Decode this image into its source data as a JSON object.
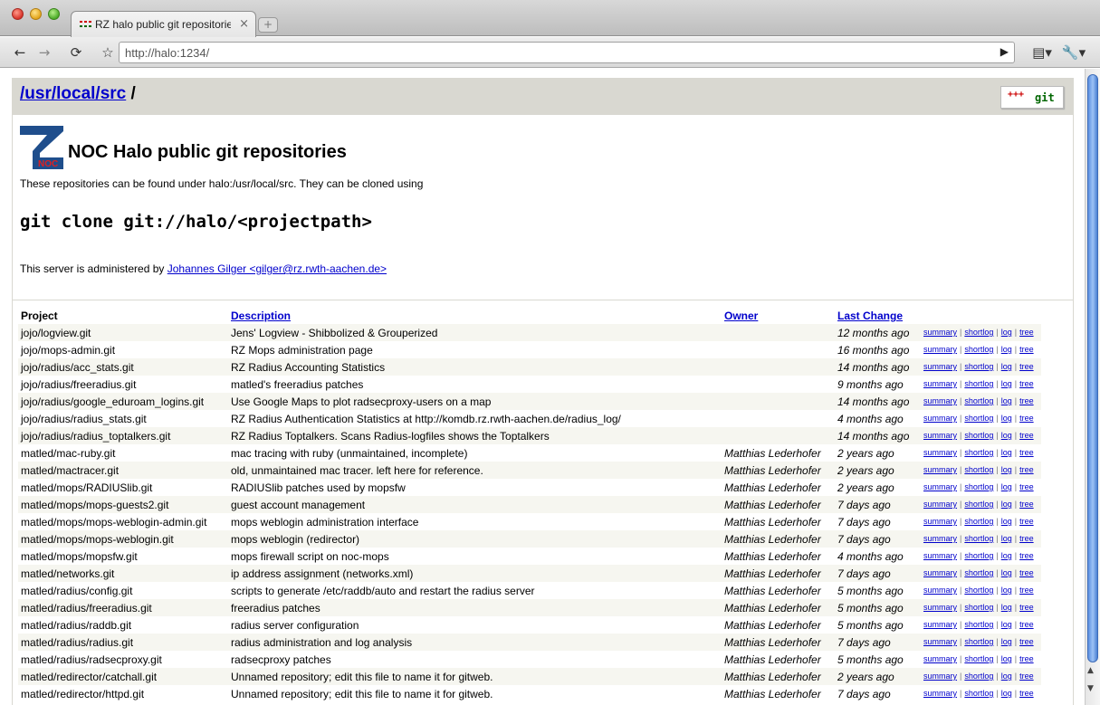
{
  "browser": {
    "tab_title": "RZ halo public git repositories",
    "tab_close": "×",
    "new_tab": "+",
    "back": "←",
    "forward": "→",
    "reload": "⟳",
    "star": "☆",
    "url": "http://halo:1234/",
    "go": "▶",
    "page_menu": "▤▾",
    "tools_menu": "🔧▾",
    "scroll_up": "▲",
    "scroll_down": "▼"
  },
  "header": {
    "crumb_link": "/usr/local/src",
    "crumb_sep": " /",
    "git_plus": "+++",
    "git_word": "git"
  },
  "intro": {
    "noc_logo_text": "NOC",
    "title": "NOC Halo public git repositories",
    "text": "These repositories can be found under halo:/usr/local/src. They can be cloned using",
    "clone_cmd": "git clone git://halo/<projectpath>",
    "admin_prefix": "This server is administered by ",
    "admin_link": "Johannes Gilger <gilger@rz.rwth-aachen.de>"
  },
  "table": {
    "headers": {
      "project": "Project",
      "description": "Description",
      "owner": "Owner",
      "last_change": "Last Change"
    },
    "links": {
      "summary": "summary",
      "shortlog": "shortlog",
      "log": "log",
      "tree": "tree",
      "sep": "|"
    },
    "rows": [
      {
        "project": "jojo/logview.git",
        "description": "Jens' Logview - Shibbolized & Grouperized",
        "owner": "",
        "age": "12 months ago"
      },
      {
        "project": "jojo/mops-admin.git",
        "description": "RZ Mops administration page",
        "owner": "",
        "age": "16 months ago"
      },
      {
        "project": "jojo/radius/acc_stats.git",
        "description": "RZ Radius Accounting Statistics",
        "owner": "",
        "age": "14 months ago"
      },
      {
        "project": "jojo/radius/freeradius.git",
        "description": "matled's freeradius patches",
        "owner": "",
        "age": "9 months ago"
      },
      {
        "project": "jojo/radius/google_eduroam_logins.git",
        "description": "Use Google Maps to plot radsecproxy-users on a map",
        "owner": "",
        "age": "14 months ago"
      },
      {
        "project": "jojo/radius/radius_stats.git",
        "description": "RZ Radius Authentication Statistics at http://komdb.rz.rwth-aachen.de/radius_log/",
        "owner": "",
        "age": "4 months ago"
      },
      {
        "project": "jojo/radius/radius_toptalkers.git",
        "description": "RZ Radius Toptalkers. Scans Radius-logfiles shows the Toptalkers",
        "owner": "",
        "age": "14 months ago"
      },
      {
        "project": "matled/mac-ruby.git",
        "description": "mac tracing with ruby (unmaintained, incomplete)",
        "owner": "Matthias Lederhofer",
        "age": "2 years ago"
      },
      {
        "project": "matled/mactracer.git",
        "description": "old, unmaintained mac tracer. left here for reference.",
        "owner": "Matthias Lederhofer",
        "age": "2 years ago"
      },
      {
        "project": "matled/mops/RADIUSlib.git",
        "description": "RADIUSlib patches used by mopsfw",
        "owner": "Matthias Lederhofer",
        "age": "2 years ago"
      },
      {
        "project": "matled/mops/mops-guests2.git",
        "description": "guest account management",
        "owner": "Matthias Lederhofer",
        "age": "7 days ago"
      },
      {
        "project": "matled/mops/mops-weblogin-admin.git",
        "description": "mops weblogin administration interface",
        "owner": "Matthias Lederhofer",
        "age": "7 days ago"
      },
      {
        "project": "matled/mops/mops-weblogin.git",
        "description": "mops weblogin (redirector)",
        "owner": "Matthias Lederhofer",
        "age": "7 days ago"
      },
      {
        "project": "matled/mops/mopsfw.git",
        "description": "mops firewall script on noc-mops",
        "owner": "Matthias Lederhofer",
        "age": "4 months ago"
      },
      {
        "project": "matled/networks.git",
        "description": "ip address assignment (networks.xml)",
        "owner": "Matthias Lederhofer",
        "age": "7 days ago"
      },
      {
        "project": "matled/radius/config.git",
        "description": "scripts to generate /etc/raddb/auto and restart the radius server",
        "owner": "Matthias Lederhofer",
        "age": "5 months ago"
      },
      {
        "project": "matled/radius/freeradius.git",
        "description": "freeradius patches",
        "owner": "Matthias Lederhofer",
        "age": "5 months ago"
      },
      {
        "project": "matled/radius/raddb.git",
        "description": "radius server configuration",
        "owner": "Matthias Lederhofer",
        "age": "5 months ago"
      },
      {
        "project": "matled/radius/radius.git",
        "description": "radius administration and log analysis",
        "owner": "Matthias Lederhofer",
        "age": "7 days ago"
      },
      {
        "project": "matled/radius/radsecproxy.git",
        "description": "radsecproxy patches",
        "owner": "Matthias Lederhofer",
        "age": "5 months ago"
      },
      {
        "project": "matled/redirector/catchall.git",
        "description": "Unnamed repository; edit this file to name it for gitweb.",
        "owner": "Matthias Lederhofer",
        "age": "2 years ago"
      },
      {
        "project": "matled/redirector/httpd.git",
        "description": "Unnamed repository; edit this file to name it for gitweb.",
        "owner": "Matthias Lederhofer",
        "age": "7 days ago"
      }
    ]
  }
}
